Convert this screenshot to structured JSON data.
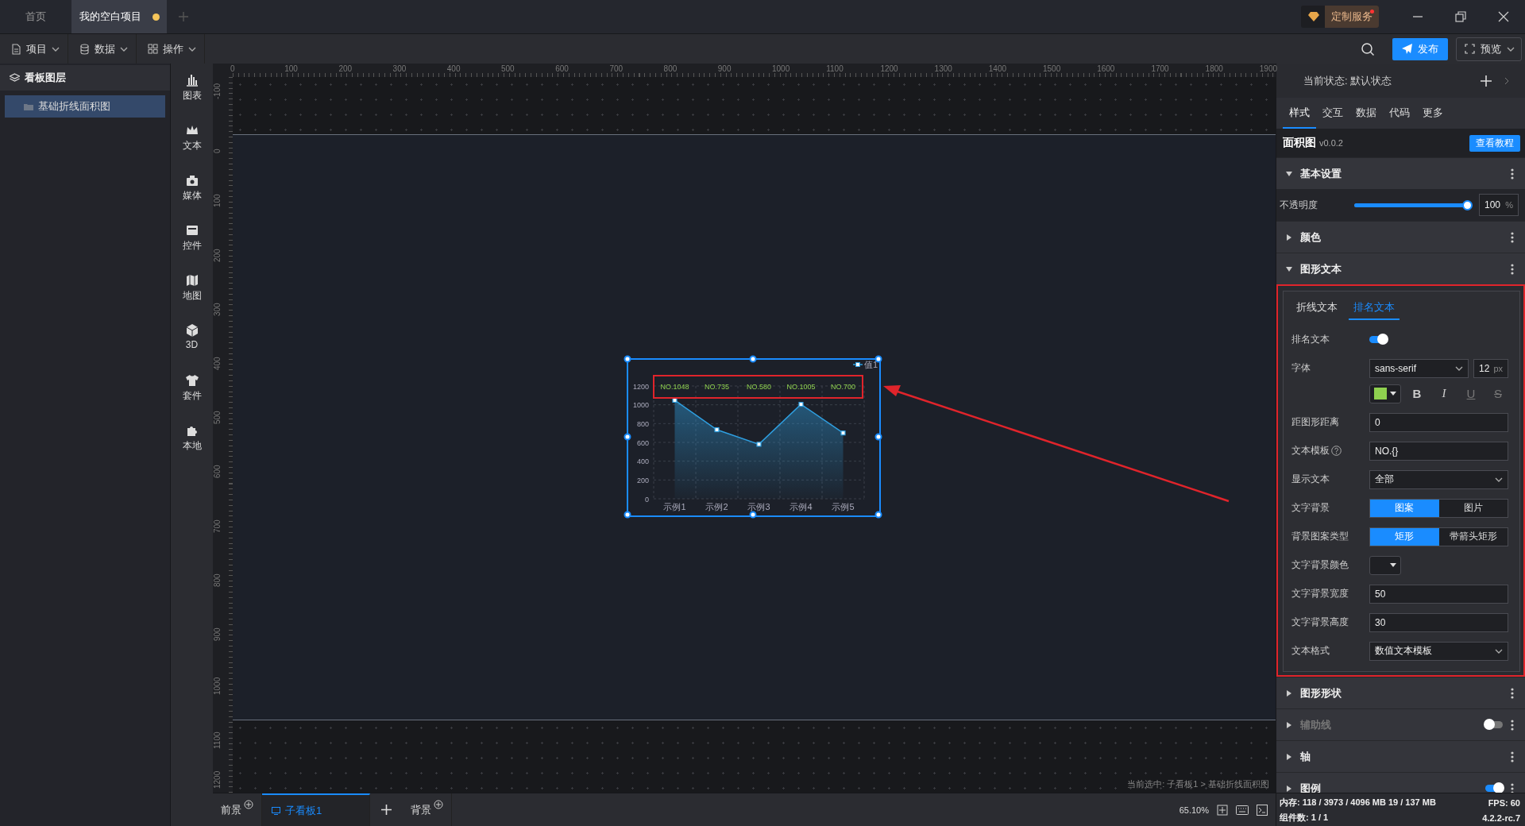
{
  "window": {
    "tabs": [
      {
        "label": "首页",
        "selected": false,
        "unsaved": false
      },
      {
        "label": "我的空白项目",
        "selected": true,
        "unsaved": true
      }
    ],
    "custom_service": "定制服务"
  },
  "toolbar": {
    "menus": [
      {
        "label": "项目",
        "kind": "file"
      },
      {
        "label": "数据",
        "kind": "database"
      },
      {
        "label": "操作",
        "kind": "grid"
      }
    ],
    "publish": "发布",
    "preview": "预览"
  },
  "layers": {
    "title": "看板图层",
    "items": [
      {
        "label": "基础折线面积图",
        "selected": true
      }
    ]
  },
  "components": [
    {
      "label": "图表",
      "kind": "chart"
    },
    {
      "label": "文本",
      "kind": "text"
    },
    {
      "label": "媒体",
      "kind": "media"
    },
    {
      "label": "控件",
      "kind": "control"
    },
    {
      "label": "地图",
      "kind": "map"
    },
    {
      "label": "3D",
      "kind": "cube"
    },
    {
      "label": "套件",
      "kind": "kit"
    },
    {
      "label": "本地",
      "kind": "local"
    }
  ],
  "ruler": {
    "x_labels": [
      "0",
      "100",
      "200",
      "300",
      "400",
      "500",
      "600",
      "700",
      "800",
      "900",
      "1000",
      "1100",
      "1200",
      "1300",
      "1400",
      "1500",
      "1600",
      "1700",
      "1800",
      "1900"
    ],
    "y_labels": [
      "-100",
      "0",
      "100",
      "200",
      "300",
      "400",
      "500",
      "600",
      "700",
      "800",
      "900",
      "1000",
      "1100",
      "1200"
    ]
  },
  "canvas": {
    "chart": {
      "selected": true,
      "annotated": true,
      "chart_data": {
        "type": "area",
        "categories": [
          "示例1",
          "示例2",
          "示例3",
          "示例4",
          "示例5"
        ],
        "series": [
          {
            "name": "值1",
            "color": "#2f9fe0",
            "values": [
              1048,
              735,
              580,
              1005,
              700
            ]
          }
        ],
        "grid": true,
        "ylim": [
          0,
          1200
        ],
        "yticks": [
          0,
          200,
          400,
          600,
          800,
          1000,
          1200
        ],
        "value_labels": [
          "NO.1048",
          "NO.735",
          "NO.580",
          "NO.1005",
          "NO.700"
        ]
      }
    },
    "breadcrumb": "当前选中: 子看板1 > 基础折线面积图"
  },
  "bottom_tabs": [
    {
      "label": "前景",
      "kind": "layer",
      "selected": false
    },
    {
      "label": "子看板1",
      "kind": "board",
      "selected": true
    },
    {
      "label": "背景",
      "kind": "layer",
      "selected": false
    }
  ],
  "zoom": "65.10%",
  "inspector": {
    "state": "当前状态: 默认状态",
    "tabs": [
      {
        "label": "样式",
        "selected": true
      },
      {
        "label": "交互",
        "selected": false
      },
      {
        "label": "数据",
        "selected": false
      },
      {
        "label": "代码",
        "selected": false
      },
      {
        "label": "更多",
        "selected": false
      }
    ],
    "component": {
      "name": "面积图",
      "version": "v0.0.2",
      "tutorial": "查看教程"
    },
    "sections": [
      {
        "title": "基本设置",
        "expanded": true,
        "disabled": false,
        "rows": [
          {
            "kind": "slider",
            "label": "不透明度",
            "level": 1,
            "value": "100",
            "unit": "%"
          }
        ]
      },
      {
        "title": "颜色",
        "expanded": false,
        "disabled": false
      },
      {
        "title": "图形文本",
        "expanded": true,
        "disabled": false,
        "annotated": true,
        "subtabs": [
          {
            "label": "折线文本",
            "selected": false
          },
          {
            "label": "排名文本",
            "selected": true
          }
        ],
        "rows": [
          {
            "kind": "toggle",
            "label": "排名文本",
            "on": true
          },
          {
            "kind": "font",
            "label": "字体",
            "value": "sans-serif",
            "size": "12",
            "unit": "px"
          },
          {
            "kind": "text_style",
            "color": "#8fd14f",
            "styles": [
              {
                "label": "B",
                "kind": "bold",
                "disabled": false
              },
              {
                "label": "I",
                "kind": "italic",
                "disabled": false
              },
              {
                "label": "U",
                "kind": "underline",
                "disabled": true
              },
              {
                "label": "S",
                "kind": "strikethrough",
                "disabled": true
              }
            ]
          },
          {
            "kind": "input",
            "label": "距图形距离",
            "value": "0"
          },
          {
            "kind": "input",
            "label": "文本模板",
            "value": "NO.{}",
            "help": true
          },
          {
            "kind": "select",
            "label": "显示文本",
            "value": "全部"
          },
          {
            "kind": "segmented",
            "label": "文字背景",
            "options": [
              {
                "label": "图案",
                "selected": true
              },
              {
                "label": "图片",
                "selected": false
              }
            ]
          },
          {
            "kind": "segmented",
            "label": "背景图案类型",
            "options": [
              {
                "label": "矩形",
                "selected": true
              },
              {
                "label": "带箭头矩形",
                "selected": false
              }
            ]
          },
          {
            "kind": "color_select",
            "label": "文字背景颜色"
          },
          {
            "kind": "input",
            "label": "文字背景宽度",
            "value": "50"
          },
          {
            "kind": "input",
            "label": "文字背景高度",
            "value": "30"
          },
          {
            "kind": "select",
            "label": "文本格式",
            "value": "数值文本模板"
          }
        ]
      },
      {
        "title": "图形形状",
        "expanded": false,
        "disabled": false
      },
      {
        "title": "辅助线",
        "expanded": false,
        "disabled": true,
        "toggle": false
      },
      {
        "title": "轴",
        "expanded": false,
        "disabled": false
      },
      {
        "title": "图例",
        "expanded": false,
        "disabled": false,
        "toggle": true
      }
    ]
  },
  "status": {
    "memory": "内存: 118 / 3973 / 4096 MB  19 / 137 MB",
    "fps": "FPS: 60",
    "components": "组件数: 1 / 1",
    "version": "4.2.2-rc.7"
  }
}
